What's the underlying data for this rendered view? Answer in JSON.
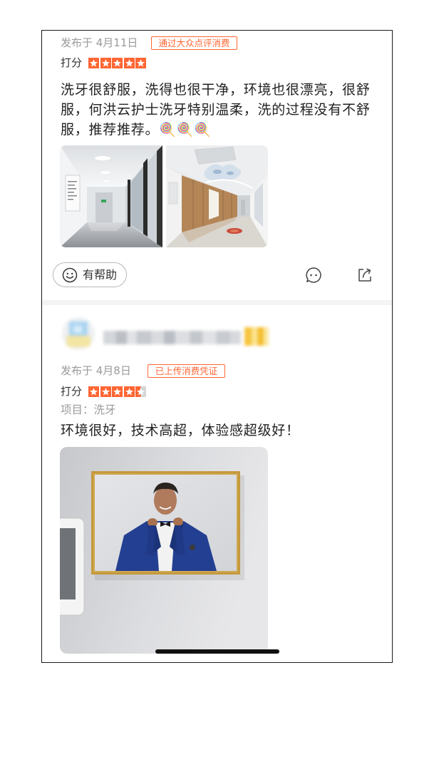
{
  "colors": {
    "accent": "#ff6633",
    "star_empty": "#d6d6d6"
  },
  "icons": {
    "helpful": "smiley-icon",
    "comment": "comment-icon",
    "share": "share-icon",
    "star": "star-icon"
  },
  "reviews": [
    {
      "published": "发布于 4月11日",
      "badge": "通过大众点评消费",
      "rating_label": "打分",
      "rating": 5,
      "text": "洗牙很舒服，洗得也很干净，环境也很漂亮，很舒服，何洪云护士洗牙特别温柔，洗的过程没有不舒服，推荐推荐。🍭🍭🍭",
      "helpful_label": "有帮助"
    },
    {
      "published": "发布于 4月8日",
      "badge": "已上传消费凭证",
      "rating_label": "打分",
      "rating": 4.5,
      "project_label": "项目：",
      "project": "洗牙",
      "text": "环境很好，技术高超，体验感超级好！"
    }
  ]
}
